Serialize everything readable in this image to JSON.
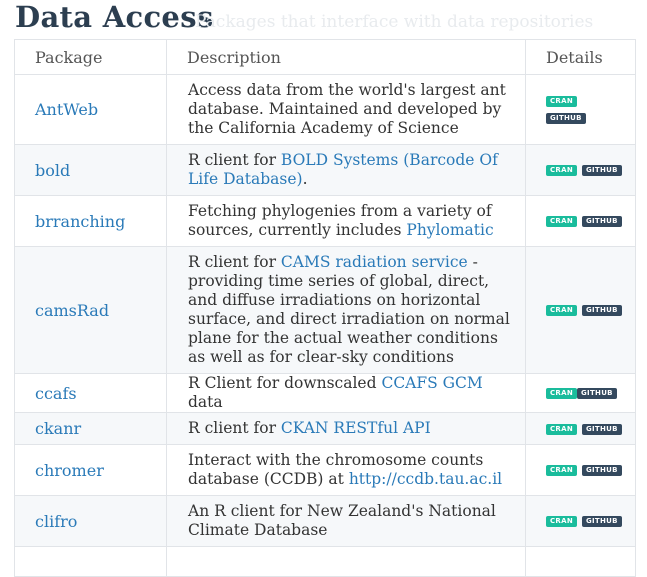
{
  "page": {
    "title": "Data Access",
    "subtitle": "Packages that interface with data repositories"
  },
  "table": {
    "headers": [
      "Package",
      "Description",
      "Details"
    ],
    "badges": {
      "cran": "CRAN",
      "github": "GITHUB"
    },
    "rows": [
      {
        "package": "AntWeb",
        "desc_pre": "Access data from the world's largest ant database. Maintained and developed by the California Academy of Science",
        "desc_link": "",
        "desc_post": ""
      },
      {
        "package": "bold",
        "desc_pre": "R client for ",
        "desc_link": "BOLD Systems (Barcode Of Life Database)",
        "desc_post": "."
      },
      {
        "package": "brranching",
        "desc_pre": "Fetching phylogenies from a variety of sources, currently includes ",
        "desc_link": "Phylomatic",
        "desc_post": ""
      },
      {
        "package": "camsRad",
        "desc_pre": "R client for ",
        "desc_link": "CAMS radiation service",
        "desc_post": " - providing time series of global, direct, and diffuse irradiations on horizontal surface, and direct irradiation on normal plane for the actual weather conditions as well as for clear-sky conditions"
      },
      {
        "package": "ccafs",
        "desc_pre": "R Client for downscaled ",
        "desc_link": "CCAFS GCM",
        "desc_post": " data"
      },
      {
        "package": "ckanr",
        "desc_pre": "R client for ",
        "desc_link": "CKAN RESTful API",
        "desc_post": ""
      },
      {
        "package": "chromer",
        "desc_pre": "Interact with the chromosome counts database (CCDB) at ",
        "desc_link": "http://ccdb.tau.ac.il",
        "desc_post": ""
      },
      {
        "package": "clifro",
        "desc_pre": "An R client for New Zealand's National Climate Database",
        "desc_link": "",
        "desc_post": ""
      }
    ]
  }
}
